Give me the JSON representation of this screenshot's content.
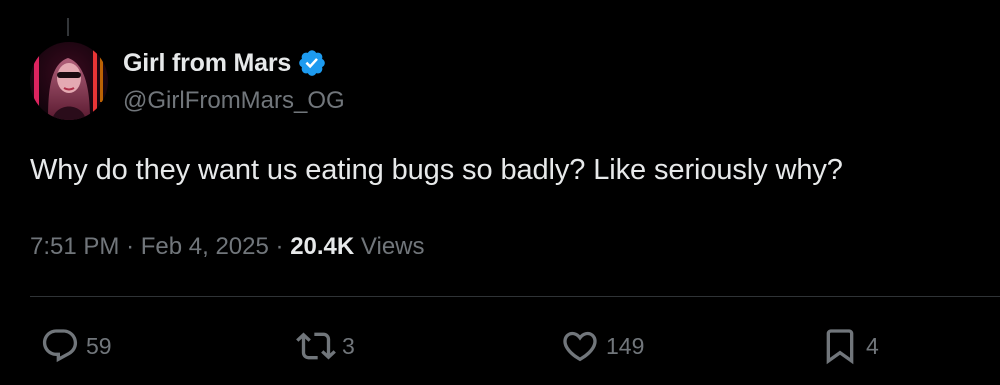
{
  "tweet": {
    "author": {
      "display_name": "Girl from Mars",
      "handle": "@GirlFromMars_OG",
      "verified": true,
      "avatar_icon": "profile-photo-neon"
    },
    "text": "Why do they want us eating bugs so badly? Like seriously why?",
    "time": "7:51 PM",
    "separator": "·",
    "date": "Feb 4, 2025",
    "views_count": "20.4K",
    "views_label": "Views"
  },
  "actions": {
    "reply": {
      "icon": "reply-icon",
      "count": "59"
    },
    "retweet": {
      "icon": "retweet-icon",
      "count": "3"
    },
    "like": {
      "icon": "heart-icon",
      "count": "149"
    },
    "bookmark": {
      "icon": "bookmark-icon",
      "count": "4"
    }
  },
  "colors": {
    "background": "#000000",
    "primary_text": "#e7e9ea",
    "secondary_text": "#71767b",
    "divider": "#2f3336",
    "verified_badge": "#1d9bf0"
  }
}
